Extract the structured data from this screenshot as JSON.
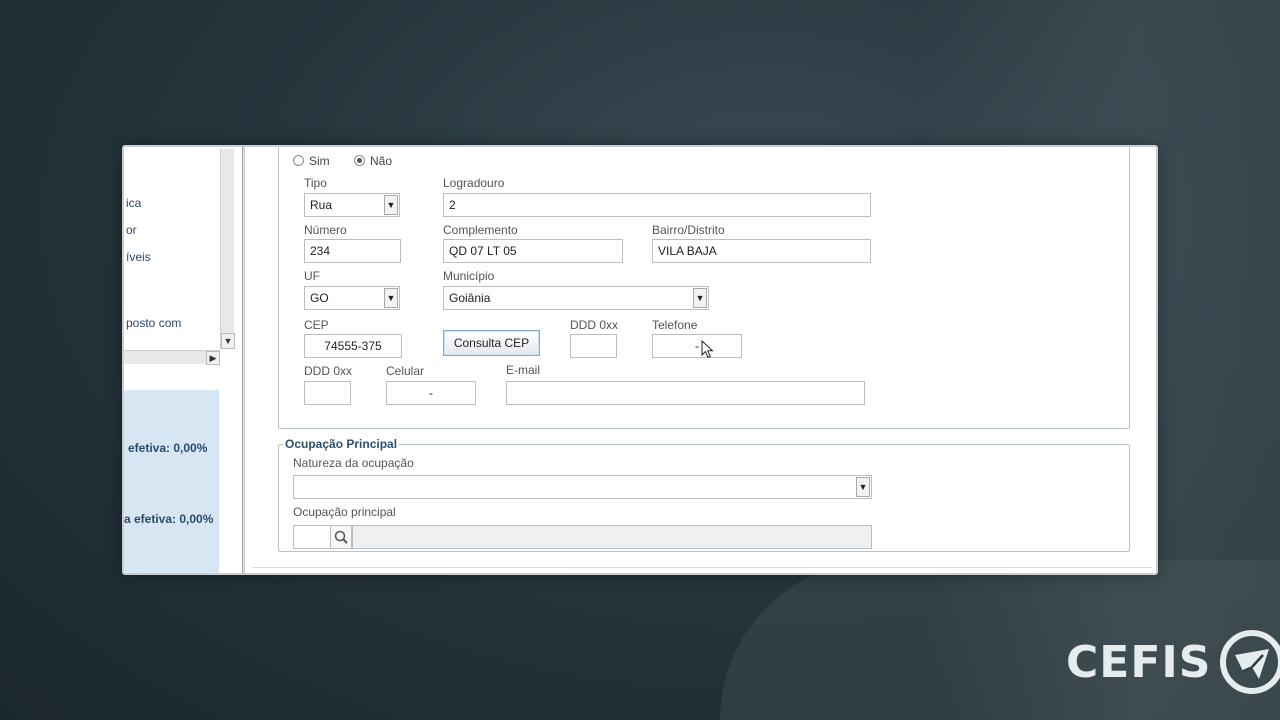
{
  "left_panel": {
    "items": [
      "ica",
      "or",
      "íveis",
      "posto com"
    ],
    "rates": [
      "efetiva: 0,00%",
      "a efetiva: 0,00%"
    ]
  },
  "address": {
    "radio_yes": "Sim",
    "radio_no": "Não",
    "radio_selected": "Não",
    "tipo_label": "Tipo",
    "tipo_value": "Rua",
    "logradouro_label": "Logradouro",
    "logradouro_value": "2",
    "numero_label": "Número",
    "numero_value": "234",
    "complemento_label": "Complemento",
    "complemento_value": "QD 07 LT 05",
    "bairro_label": "Bairro/Distrito",
    "bairro_value": "VILA BAJA",
    "uf_label": "UF",
    "uf_value": "GO",
    "municipio_label": "Município",
    "municipio_value": "Goiânia",
    "cep_label": "CEP",
    "cep_value": "74555-375",
    "consulta_cep_label": "Consulta CEP",
    "ddd1_label": "DDD 0xx",
    "ddd1_value": "",
    "telefone_label": "Telefone",
    "telefone_value": "-",
    "ddd2_label": "DDD 0xx",
    "ddd2_value": "",
    "celular_label": "Celular",
    "celular_value": "-",
    "email_label": "E-mail",
    "email_value": ""
  },
  "ocupacao": {
    "legend": "Ocupação Principal",
    "natureza_label": "Natureza da ocupação",
    "natureza_value": "",
    "principal_label": "Ocupação principal",
    "principal_code": "",
    "principal_desc": ""
  },
  "brand": {
    "logo_text": "CEFIS",
    "color": "#e6ebee"
  }
}
